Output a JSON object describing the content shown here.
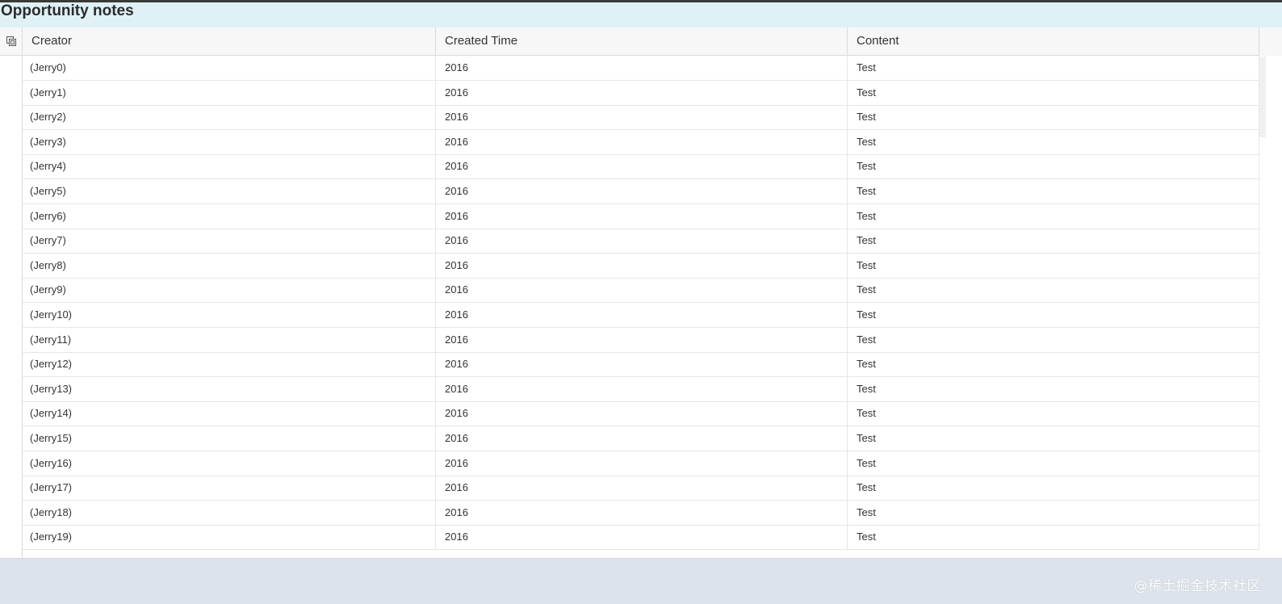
{
  "panel": {
    "title": "Opportunity notes"
  },
  "table": {
    "columns": [
      "Creator",
      "Created Time",
      "Content"
    ],
    "rows": [
      {
        "creator": "(Jerry0)",
        "created_time": "2016",
        "content": "Test"
      },
      {
        "creator": "(Jerry1)",
        "created_time": "2016",
        "content": "Test"
      },
      {
        "creator": "(Jerry2)",
        "created_time": "2016",
        "content": "Test"
      },
      {
        "creator": "(Jerry3)",
        "created_time": "2016",
        "content": "Test"
      },
      {
        "creator": "(Jerry4)",
        "created_time": "2016",
        "content": "Test"
      },
      {
        "creator": "(Jerry5)",
        "created_time": "2016",
        "content": "Test"
      },
      {
        "creator": "(Jerry6)",
        "created_time": "2016",
        "content": "Test"
      },
      {
        "creator": "(Jerry7)",
        "created_time": "2016",
        "content": "Test"
      },
      {
        "creator": "(Jerry8)",
        "created_time": "2016",
        "content": "Test"
      },
      {
        "creator": "(Jerry9)",
        "created_time": "2016",
        "content": "Test"
      },
      {
        "creator": "(Jerry10)",
        "created_time": "2016",
        "content": "Test"
      },
      {
        "creator": "(Jerry11)",
        "created_time": "2016",
        "content": "Test"
      },
      {
        "creator": "(Jerry12)",
        "created_time": "2016",
        "content": "Test"
      },
      {
        "creator": "(Jerry13)",
        "created_time": "2016",
        "content": "Test"
      },
      {
        "creator": "(Jerry14)",
        "created_time": "2016",
        "content": "Test"
      },
      {
        "creator": "(Jerry15)",
        "created_time": "2016",
        "content": "Test"
      },
      {
        "creator": "(Jerry16)",
        "created_time": "2016",
        "content": "Test"
      },
      {
        "creator": "(Jerry17)",
        "created_time": "2016",
        "content": "Test"
      },
      {
        "creator": "(Jerry18)",
        "created_time": "2016",
        "content": "Test"
      },
      {
        "creator": "(Jerry19)",
        "created_time": "2016",
        "content": "Test"
      }
    ],
    "select_all_icon": "select-all-icon"
  },
  "watermark": {
    "text": "@稀土掘金技术社区"
  },
  "colors": {
    "title_bar_bg": "#dff1f5",
    "header_bg": "#f7f7f7",
    "page_bg": "#dde3ea"
  }
}
